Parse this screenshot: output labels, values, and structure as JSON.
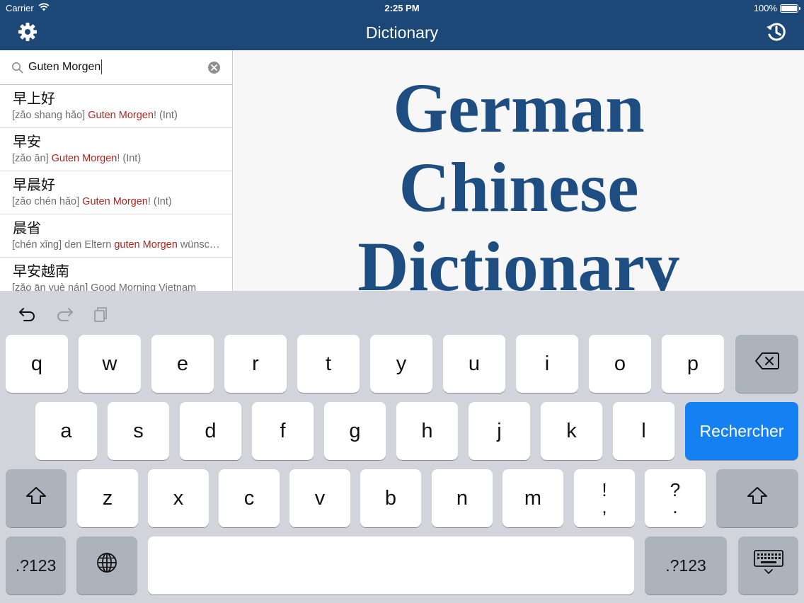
{
  "status_bar": {
    "carrier": "Carrier",
    "time": "2:25 PM",
    "battery": "100%",
    "battery_level": 1.0
  },
  "nav": {
    "title": "Dictionary",
    "settings_icon": "gear-icon",
    "history_icon": "history-icon"
  },
  "search": {
    "value": "Guten Morgen"
  },
  "results": [
    {
      "hanzi": "早上好",
      "pinyin": "[zǎo shang hǎo]",
      "pre": "",
      "highlight": "Guten Morgen",
      "post": "! (Int)"
    },
    {
      "hanzi": "早安",
      "pinyin": "[zǎo ān]",
      "pre": "",
      "highlight": "Guten Morgen",
      "post": "! (Int)"
    },
    {
      "hanzi": "早晨好",
      "pinyin": "[zǎo chén hǎo]",
      "pre": "",
      "highlight": "Guten Morgen",
      "post": "! (Int)"
    },
    {
      "hanzi": "晨省",
      "pinyin": "[chén xǐng]",
      "pre": "den Eltern",
      "highlight": "guten Morgen",
      "post": "wünschen"
    },
    {
      "hanzi": "早安越南",
      "pinyin": "[zǎo ān yuè nán]",
      "pre": "Good Morning Vietnam",
      "highlight": "",
      "post": ""
    }
  ],
  "logo": {
    "line1": "German",
    "line2": "Chinese",
    "line3": "Dictionary"
  },
  "keyboard": {
    "row1": [
      "q",
      "w",
      "e",
      "r",
      "t",
      "y",
      "u",
      "i",
      "o",
      "p"
    ],
    "row2": [
      "a",
      "s",
      "d",
      "f",
      "g",
      "h",
      "j",
      "k",
      "l"
    ],
    "row3": [
      "z",
      "x",
      "c",
      "v",
      "b",
      "n",
      "m"
    ],
    "punct1": {
      "top": "!",
      "bottom": ","
    },
    "punct2": {
      "top": "?",
      "bottom": "."
    },
    "search_key": "Rechercher",
    "numbers_key": ".?123",
    "colors": {
      "accent": "#1580f2",
      "nav": "#1c4878",
      "highlight": "#b0241d"
    }
  }
}
